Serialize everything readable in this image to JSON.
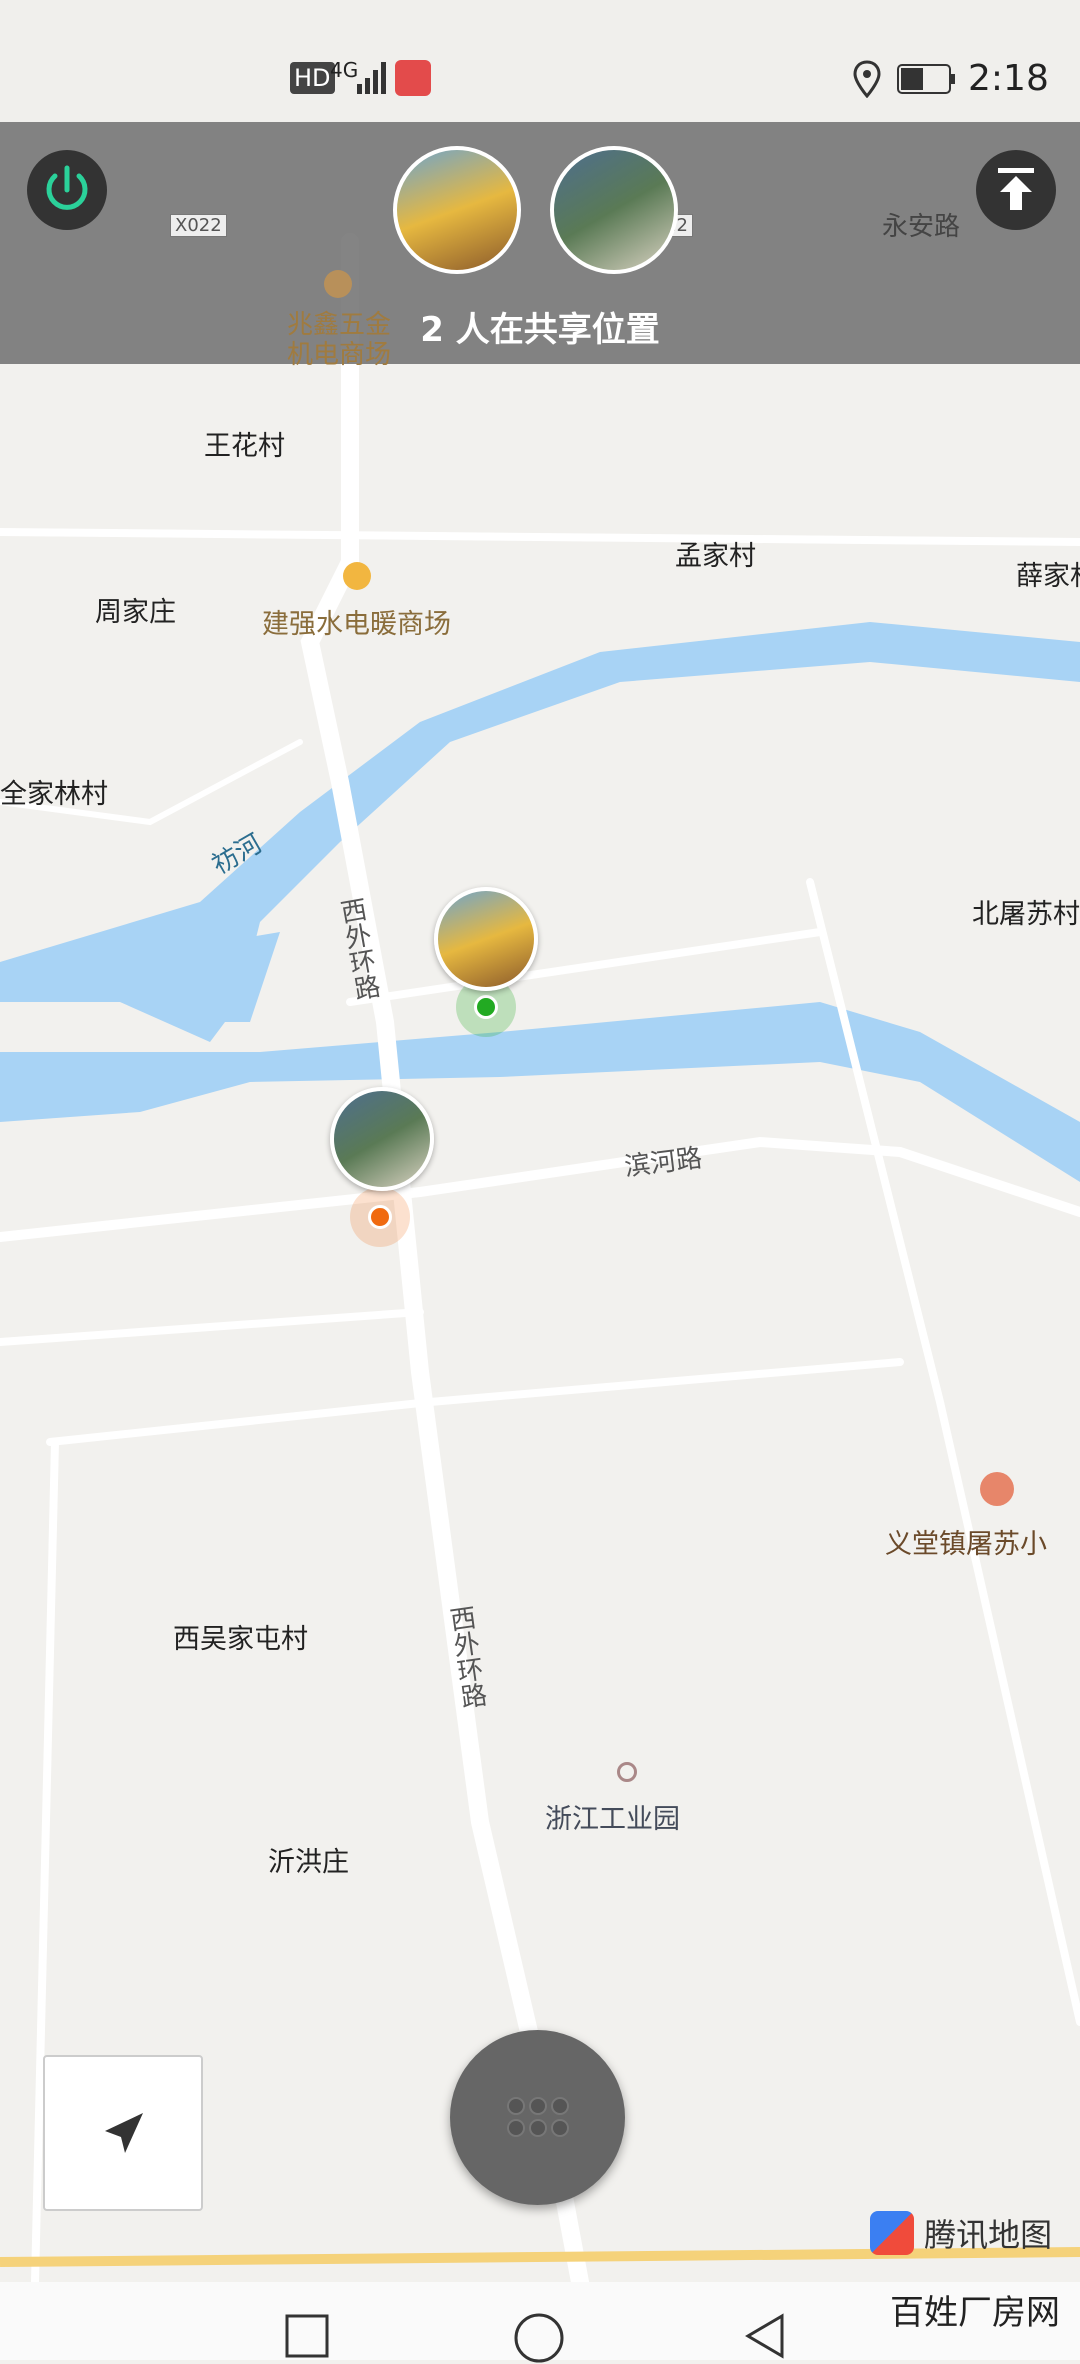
{
  "status_bar": {
    "left_icons": [
      "HD",
      "4G",
      "signal-icon",
      "huawei-icon"
    ],
    "time": "2:18"
  },
  "overlay": {
    "share_text": "2 人在共享位置",
    "buttons": {
      "power": "power-icon",
      "upload": "upload-icon"
    },
    "road_tags": [
      "X022",
      "22"
    ],
    "poi_top": "兆鑫五金\n机电商场",
    "road_top": "永安路"
  },
  "map": {
    "places": {
      "wanghua": "王花村",
      "zhoujia": "周家庄",
      "mengjia": "孟家村",
      "xuejia": "薛家村",
      "quanjialin": "全家林村",
      "beijusu": "北屠苏村",
      "xiwujiatun": "西吴家屯村",
      "yihong": "沂洪庄"
    },
    "pois": {
      "jianqiang": "建强水电暖商场",
      "yitang": "义堂镇屠苏小",
      "zhejiang": "浙江工业园"
    },
    "roads": {
      "river": "祊河",
      "xiwai_top": "西外环路",
      "binhe": "滨河路",
      "xiwai_bottom": "西外环路"
    }
  },
  "controls": {
    "locate": "locate-arrow-icon",
    "menu": "grid-dots-icon"
  },
  "footer": {
    "map_logo": "腾讯地图",
    "watermark": "百姓厂房网"
  },
  "colors": {
    "river": "#a8d3f5",
    "road": "#ffffff",
    "land": "#f2f1ee",
    "overlay": "#6e6e6e",
    "green_dot": "#22aa22",
    "orange_dot": "#f06a10"
  }
}
